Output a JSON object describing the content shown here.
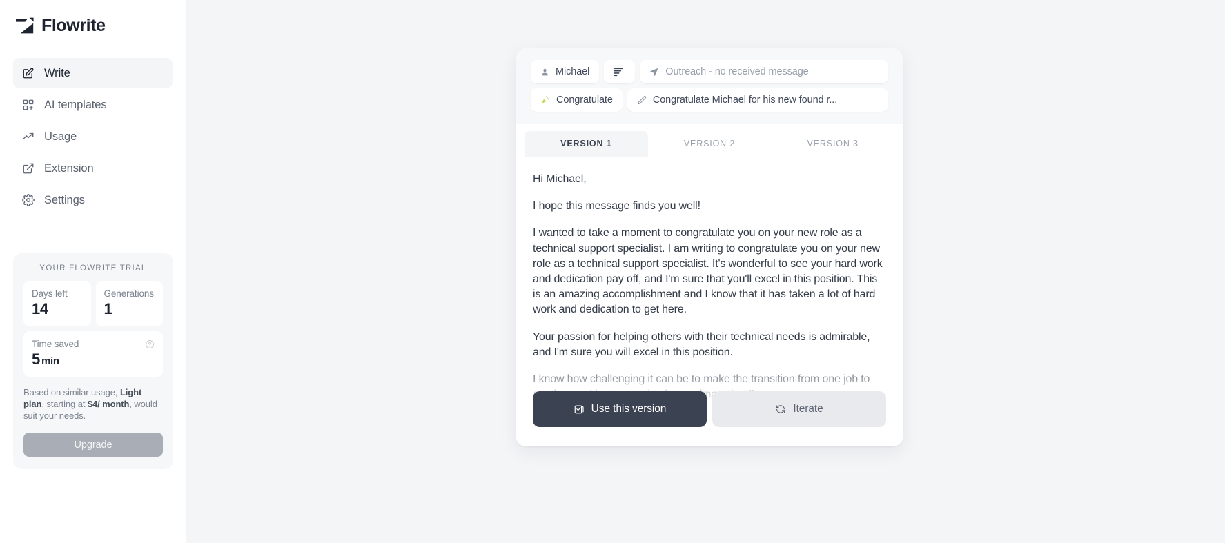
{
  "brand": {
    "name": "Flowrite",
    "logo_icon": "flowrite-logo-icon"
  },
  "sidebar": {
    "items": [
      {
        "label": "Write",
        "icon": "pencil-square-icon",
        "active": true
      },
      {
        "label": "AI templates",
        "icon": "templates-grid-icon",
        "active": false
      },
      {
        "label": "Usage",
        "icon": "trending-up-icon",
        "active": false
      },
      {
        "label": "Extension",
        "icon": "external-link-icon",
        "active": false
      },
      {
        "label": "Settings",
        "icon": "gear-icon",
        "active": false
      }
    ]
  },
  "trial": {
    "title": "YOUR FLOWRITE TRIAL",
    "stats": [
      {
        "label": "Days left",
        "value": "14",
        "unit": ""
      },
      {
        "label": "Generations",
        "value": "1",
        "unit": ""
      }
    ],
    "time_saved": {
      "label": "Time saved",
      "value": "5",
      "unit": "min",
      "help_icon": "question-circle-icon"
    },
    "note_prefix": "Based on similar usage, ",
    "note_plan": "Light plan",
    "note_middle": ", starting at ",
    "note_price": "$4/ month",
    "note_suffix": ", would suit your needs.",
    "upgrade_label": "Upgrade"
  },
  "composer": {
    "fields": {
      "recipient": {
        "value": "Michael",
        "icon": "person-icon"
      },
      "tone": {
        "value": "",
        "icon": "text-lines-icon"
      },
      "context": {
        "placeholder": "Outreach - no received message",
        "icon": "send-arrow-icon"
      },
      "intent": {
        "value": "Congratulate",
        "icon": "party-popper-icon"
      },
      "instruction": {
        "value": "Congratulate Michael for his new found r...",
        "icon": "pencil-icon"
      }
    },
    "tabs": [
      {
        "label": "VERSION 1",
        "active": true
      },
      {
        "label": "VERSION 2",
        "active": false
      },
      {
        "label": "VERSION 3",
        "active": false
      }
    ],
    "message": {
      "paragraphs": [
        "Hi Michael,",
        "I hope this message finds you well!",
        "I wanted to take a moment to congratulate you on your new role as a technical support specialist. I am writing to congratulate you on your new role as a technical support specialist. It's wonderful to see your hard work and dedication pay off, and I'm sure that you'll excel in this position. This is an amazing accomplishment and I know that it has taken a lot of hard work and dedication to get here.",
        "Your passion for helping others with their technical needs is admirable, and I'm sure you will excel in this position.",
        "I know how challenging it can be to make the transition from one job to another, so I just wanted to let you know that I'm"
      ]
    },
    "actions": {
      "use_version": {
        "label": "Use this version",
        "icon": "clipboard-check-icon"
      },
      "iterate": {
        "label": "Iterate",
        "icon": "refresh-icon"
      }
    }
  },
  "colors": {
    "accent_dark": "#3b4252",
    "sidebar_active_bg": "#f4f5f7",
    "canvas_bg": "#f4f5f7",
    "upgrade_bg": "#a9adb5"
  }
}
